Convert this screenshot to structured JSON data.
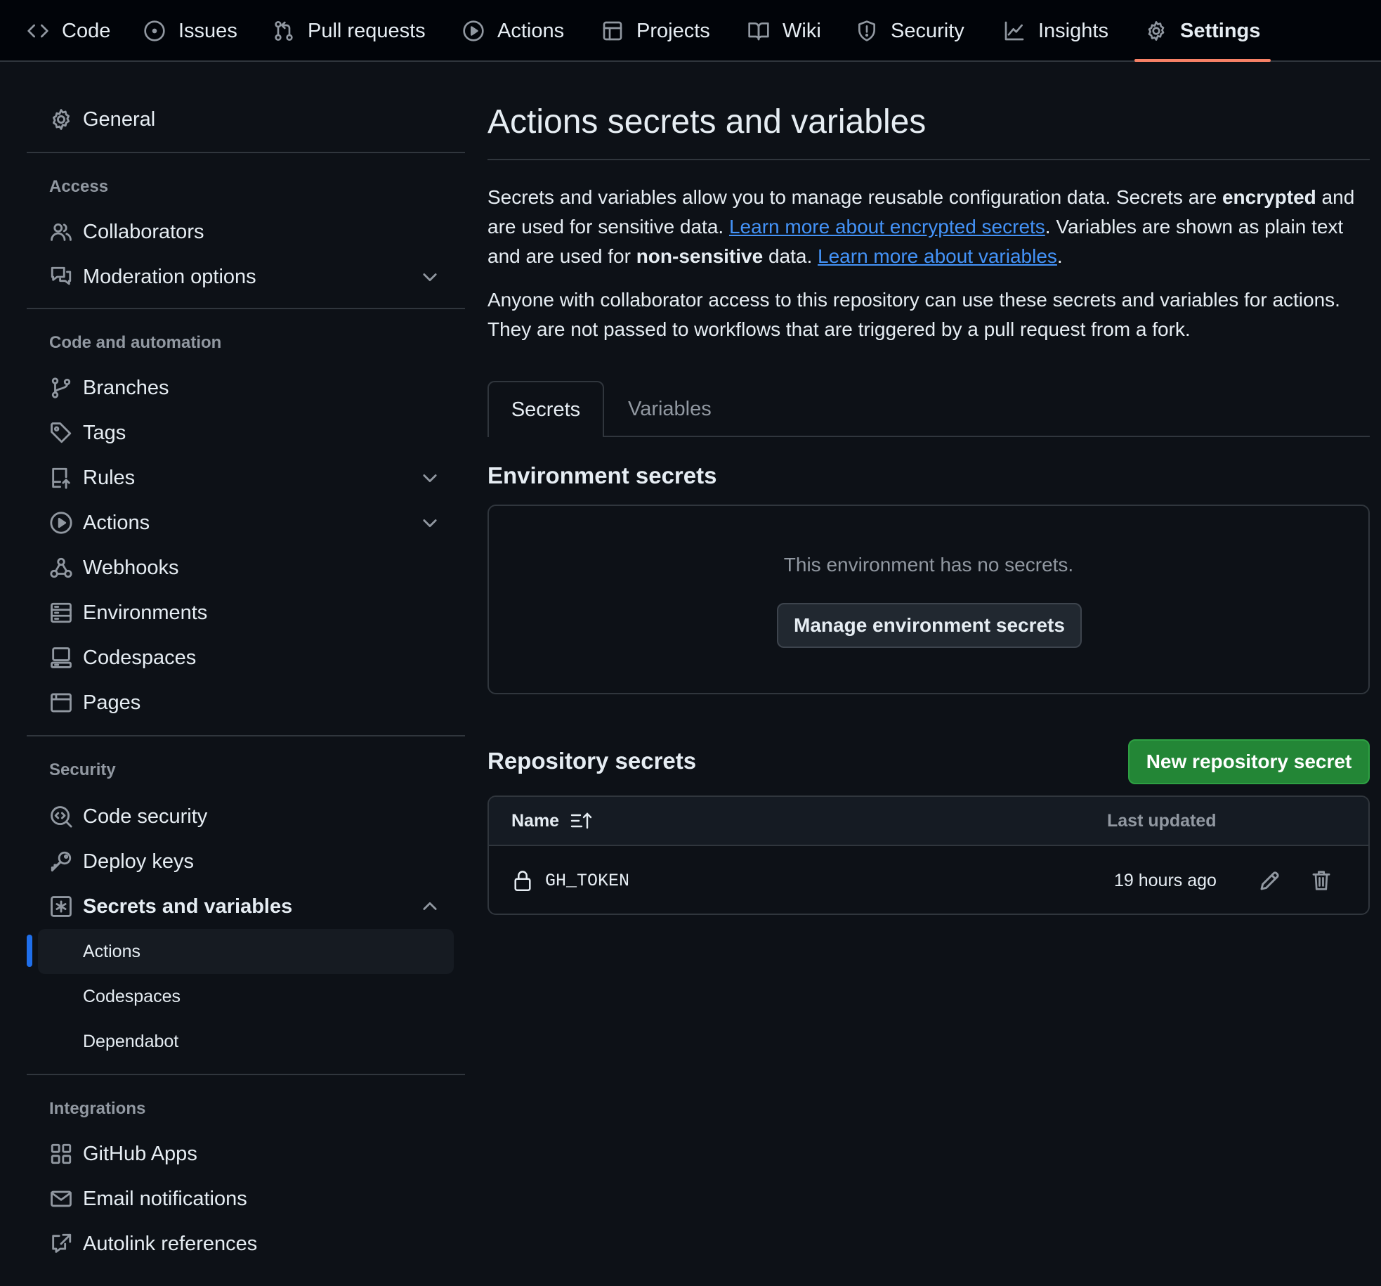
{
  "topnav": {
    "tabs": [
      {
        "label": "Code",
        "icon": "code-icon"
      },
      {
        "label": "Issues",
        "icon": "issue-opened-icon"
      },
      {
        "label": "Pull requests",
        "icon": "git-pull-request-icon"
      },
      {
        "label": "Actions",
        "icon": "play-icon"
      },
      {
        "label": "Projects",
        "icon": "table-icon"
      },
      {
        "label": "Wiki",
        "icon": "book-icon"
      },
      {
        "label": "Security",
        "icon": "shield-icon"
      },
      {
        "label": "Insights",
        "icon": "graph-icon"
      },
      {
        "label": "Settings",
        "icon": "gear-icon",
        "active": true
      }
    ]
  },
  "sidebar": {
    "general": "General",
    "access_heading": "Access",
    "collaborators": "Collaborators",
    "moderation": "Moderation options",
    "code_automation_heading": "Code and automation",
    "branches": "Branches",
    "tags": "Tags",
    "rules": "Rules",
    "actions": "Actions",
    "webhooks": "Webhooks",
    "environments": "Environments",
    "codespaces": "Codespaces",
    "pages": "Pages",
    "security_heading": "Security",
    "code_security": "Code security",
    "deploy_keys": "Deploy keys",
    "secrets_variables": "Secrets and variables",
    "sub_actions": "Actions",
    "sub_codespaces": "Codespaces",
    "sub_dependabot": "Dependabot",
    "integrations_heading": "Integrations",
    "github_apps": "GitHub Apps",
    "email_notifications": "Email notifications",
    "autolink": "Autolink references"
  },
  "main": {
    "title": "Actions secrets and variables",
    "p1_a": "Secrets and variables allow you to manage reusable configuration data. Secrets are ",
    "p1_b": "encrypted",
    "p1_c": " and are used for sensitive data. ",
    "p1_link1": "Learn more about encrypted secrets",
    "p1_d": ". Variables are shown as plain text and are used for ",
    "p1_e": "non-sensitive",
    "p1_f": " data. ",
    "p1_link2": "Learn more about variables",
    "p1_g": ".",
    "p2": "Anyone with collaborator access to this repository can use these secrets and variables for actions. They are not passed to workflows that are triggered by a pull request from a fork.",
    "tab_secrets": "Secrets",
    "tab_variables": "Variables",
    "env_heading": "Environment secrets",
    "env_empty": "This environment has no secrets.",
    "env_button": "Manage environment secrets",
    "repo_heading": "Repository secrets",
    "new_secret_button": "New repository secret",
    "table": {
      "col_name": "Name",
      "col_updated": "Last updated",
      "rows": [
        {
          "name": "GH_TOKEN",
          "updated": "19 hours ago"
        }
      ]
    }
  },
  "colors": {
    "background": "#0d1117",
    "accent_underline": "#f78166",
    "link": "#4493f8",
    "primary_button": "#238636",
    "selected_indicator": "#1f6feb"
  }
}
